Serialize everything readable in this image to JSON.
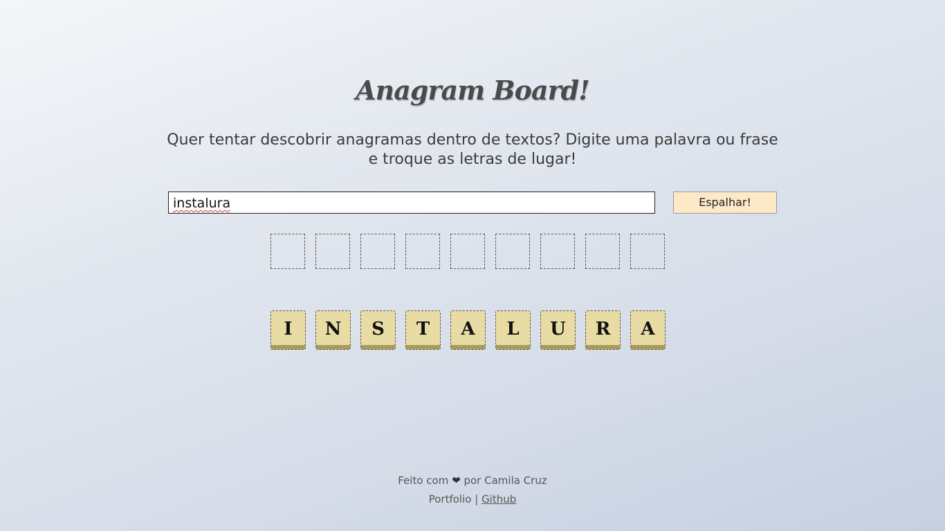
{
  "header": {
    "title": "Anagram Board!",
    "description": "Quer tentar descobrir anagramas dentro de textos? Digite uma palavra ou frase e troque as letras de lugar!"
  },
  "form": {
    "input_value": "instalura",
    "button_label": "Espalhar!"
  },
  "board": {
    "slot_count": 9,
    "tiles": [
      "I",
      "N",
      "S",
      "T",
      "A",
      "L",
      "U",
      "R",
      "A"
    ]
  },
  "footer": {
    "made_with": "Feito com",
    "heart_icon": "heart-icon",
    "by_author": "por Camila Cruz",
    "portfolio_label": "Portfolio",
    "separator": "|",
    "github_label": "Github"
  },
  "colors": {
    "tile_face": "#e8dca4",
    "tile_shadow": "#a89a5c",
    "button_bg": "#fde9c8"
  }
}
